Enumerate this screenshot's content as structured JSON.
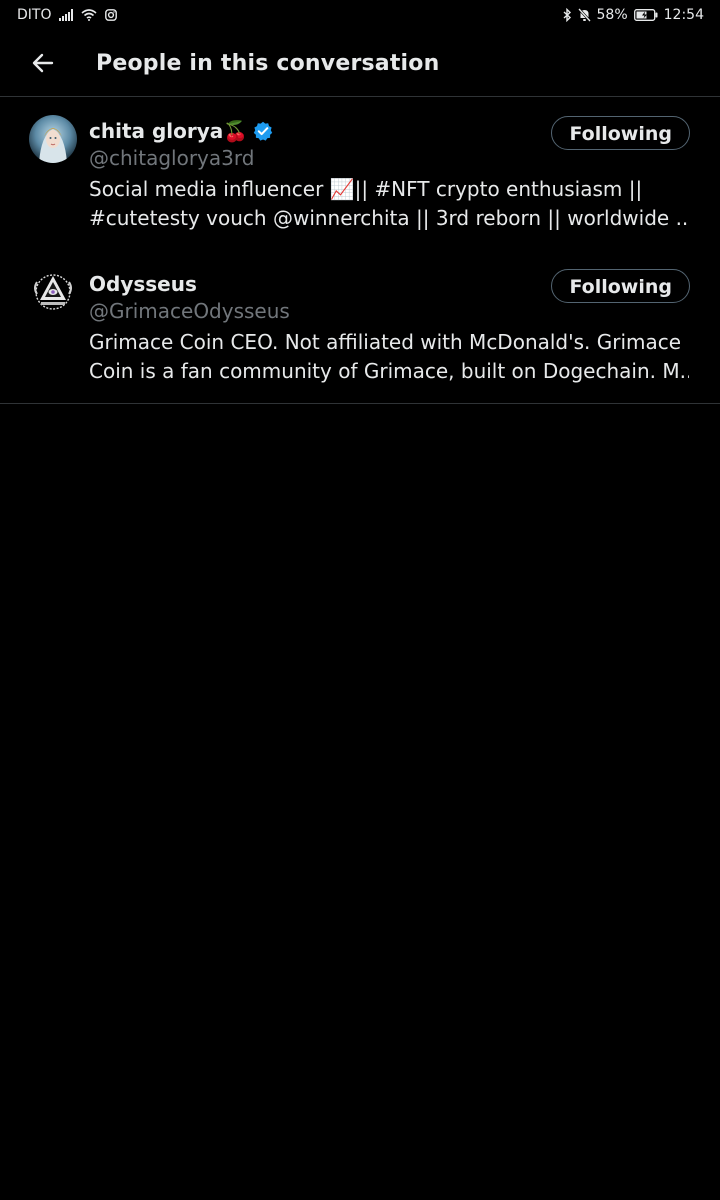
{
  "status_bar": {
    "carrier": "DITO",
    "battery": "58%",
    "time": "12:54"
  },
  "header": {
    "title": "People in this conversation"
  },
  "people": [
    {
      "display_name": "chita glorya🍒",
      "verified": true,
      "handle": "@chitaglorya3rd",
      "bio_line1": "Social media influencer 📈|| #NFT crypto enthusiasm ||",
      "bio_line2": "#cutetesty vouch @winnerchita || 3rd reborn || worldwide ...",
      "button_label": "Following"
    },
    {
      "display_name": "Odysseus",
      "verified": false,
      "handle": "@GrimaceOdysseus",
      "bio_line1": "Grimace Coin CEO. Not affiliated with McDonald's. Grimace",
      "bio_line2": "Coin is a fan community of Grimace, built on Dogechain. M...",
      "button_label": "Following"
    }
  ],
  "colors": {
    "background": "#000000",
    "text_primary": "#e7e9ea",
    "text_secondary": "#71767b",
    "divider": "#2f3336",
    "verified_blue": "#1d9bf0"
  }
}
